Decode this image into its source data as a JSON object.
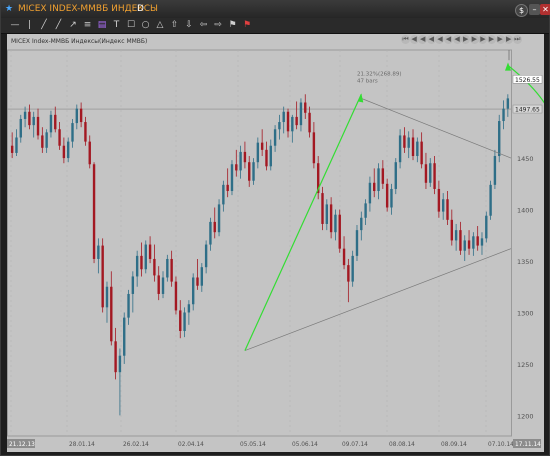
{
  "title": {
    "star": "★",
    "name": "MICEX INDEX-ММВБ ИНДЕКСЫ",
    "period": "D"
  },
  "window": {
    "info": "$",
    "minimize": "–",
    "close": "✕"
  },
  "toolbar": [
    "—",
    "|",
    "╱",
    "╱",
    "↗",
    "≡",
    "▤",
    "T",
    "☐",
    "○",
    "△",
    "⇧",
    "⇩",
    "⇦",
    "⇨",
    "⚑",
    "⚑"
  ],
  "nav_buttons": [
    "⏮",
    "◀",
    "◀",
    "◀",
    "◀",
    "◀",
    "◀",
    "▶",
    "▶",
    "▶",
    "▶",
    "▶",
    "▶",
    "⏭"
  ],
  "chart_data": {
    "type": "candlestick",
    "instrument_label": "MICEX Index-ММВБ Индексы(Индекс ММВБ)",
    "y_ticks": [
      1500,
      1450,
      1400,
      1350,
      1300,
      1250,
      1200
    ],
    "ylim": [
      1180,
      1555
    ],
    "x_ticks": [
      "21.12.13",
      "28.01.14",
      "26.02.14",
      "02.04.14",
      "05.05.14",
      "05.06.14",
      "09.07.14",
      "08.08.14",
      "08.09.14",
      "07.10.14"
    ],
    "first_label": "21.12.13",
    "last_label": "17.11.14",
    "price_labels": [
      {
        "value": "1526.55",
        "y": 1526.55
      },
      {
        "value": "1497.65",
        "y": 1497.65
      }
    ],
    "annotation": {
      "line1": "21.32%(268.89)",
      "line2": "47 bars"
    },
    "candles": [
      {
        "o": 1462,
        "h": 1475,
        "l": 1450,
        "c": 1455
      },
      {
        "o": 1455,
        "h": 1478,
        "l": 1452,
        "c": 1470
      },
      {
        "o": 1470,
        "h": 1492,
        "l": 1465,
        "c": 1488
      },
      {
        "o": 1488,
        "h": 1500,
        "l": 1480,
        "c": 1495
      },
      {
        "o": 1495,
        "h": 1502,
        "l": 1478,
        "c": 1482
      },
      {
        "o": 1482,
        "h": 1495,
        "l": 1470,
        "c": 1490
      },
      {
        "o": 1490,
        "h": 1498,
        "l": 1468,
        "c": 1472
      },
      {
        "o": 1472,
        "h": 1480,
        "l": 1455,
        "c": 1460
      },
      {
        "o": 1460,
        "h": 1478,
        "l": 1455,
        "c": 1475
      },
      {
        "o": 1475,
        "h": 1496,
        "l": 1470,
        "c": 1492
      },
      {
        "o": 1492,
        "h": 1500,
        "l": 1475,
        "c": 1478
      },
      {
        "o": 1478,
        "h": 1485,
        "l": 1458,
        "c": 1462
      },
      {
        "o": 1462,
        "h": 1470,
        "l": 1445,
        "c": 1450
      },
      {
        "o": 1450,
        "h": 1470,
        "l": 1446,
        "c": 1466
      },
      {
        "o": 1466,
        "h": 1488,
        "l": 1460,
        "c": 1484
      },
      {
        "o": 1484,
        "h": 1502,
        "l": 1478,
        "c": 1498
      },
      {
        "o": 1498,
        "h": 1504,
        "l": 1480,
        "c": 1485
      },
      {
        "o": 1485,
        "h": 1490,
        "l": 1462,
        "c": 1466
      },
      {
        "o": 1466,
        "h": 1472,
        "l": 1440,
        "c": 1444
      },
      {
        "o": 1444,
        "h": 1446,
        "l": 1348,
        "c": 1352
      },
      {
        "o": 1352,
        "h": 1372,
        "l": 1338,
        "c": 1365
      },
      {
        "o": 1365,
        "h": 1372,
        "l": 1300,
        "c": 1305
      },
      {
        "o": 1305,
        "h": 1330,
        "l": 1290,
        "c": 1325
      },
      {
        "o": 1325,
        "h": 1340,
        "l": 1268,
        "c": 1272
      },
      {
        "o": 1272,
        "h": 1285,
        "l": 1235,
        "c": 1242
      },
      {
        "o": 1242,
        "h": 1265,
        "l": 1200,
        "c": 1258
      },
      {
        "o": 1258,
        "h": 1300,
        "l": 1250,
        "c": 1295
      },
      {
        "o": 1295,
        "h": 1322,
        "l": 1288,
        "c": 1318
      },
      {
        "o": 1318,
        "h": 1340,
        "l": 1300,
        "c": 1335
      },
      {
        "o": 1335,
        "h": 1360,
        "l": 1325,
        "c": 1355
      },
      {
        "o": 1355,
        "h": 1368,
        "l": 1335,
        "c": 1342
      },
      {
        "o": 1342,
        "h": 1370,
        "l": 1338,
        "c": 1366
      },
      {
        "o": 1366,
        "h": 1374,
        "l": 1348,
        "c": 1352
      },
      {
        "o": 1352,
        "h": 1366,
        "l": 1330,
        "c": 1336
      },
      {
        "o": 1336,
        "h": 1345,
        "l": 1312,
        "c": 1318
      },
      {
        "o": 1318,
        "h": 1340,
        "l": 1314,
        "c": 1334
      },
      {
        "o": 1334,
        "h": 1356,
        "l": 1330,
        "c": 1352
      },
      {
        "o": 1352,
        "h": 1360,
        "l": 1325,
        "c": 1330
      },
      {
        "o": 1330,
        "h": 1335,
        "l": 1298,
        "c": 1302
      },
      {
        "o": 1302,
        "h": 1312,
        "l": 1275,
        "c": 1282
      },
      {
        "o": 1282,
        "h": 1305,
        "l": 1276,
        "c": 1300
      },
      {
        "o": 1300,
        "h": 1312,
        "l": 1288,
        "c": 1308
      },
      {
        "o": 1308,
        "h": 1338,
        "l": 1302,
        "c": 1334
      },
      {
        "o": 1334,
        "h": 1352,
        "l": 1322,
        "c": 1326
      },
      {
        "o": 1326,
        "h": 1348,
        "l": 1320,
        "c": 1344
      },
      {
        "o": 1344,
        "h": 1370,
        "l": 1338,
        "c": 1366
      },
      {
        "o": 1366,
        "h": 1392,
        "l": 1360,
        "c": 1388
      },
      {
        "o": 1388,
        "h": 1402,
        "l": 1372,
        "c": 1378
      },
      {
        "o": 1378,
        "h": 1410,
        "l": 1374,
        "c": 1405
      },
      {
        "o": 1405,
        "h": 1428,
        "l": 1398,
        "c": 1424
      },
      {
        "o": 1424,
        "h": 1440,
        "l": 1412,
        "c": 1418
      },
      {
        "o": 1418,
        "h": 1448,
        "l": 1414,
        "c": 1444
      },
      {
        "o": 1444,
        "h": 1458,
        "l": 1432,
        "c": 1438
      },
      {
        "o": 1438,
        "h": 1462,
        "l": 1430,
        "c": 1456
      },
      {
        "o": 1456,
        "h": 1466,
        "l": 1440,
        "c": 1446
      },
      {
        "o": 1446,
        "h": 1452,
        "l": 1422,
        "c": 1428
      },
      {
        "o": 1428,
        "h": 1450,
        "l": 1424,
        "c": 1446
      },
      {
        "o": 1446,
        "h": 1470,
        "l": 1440,
        "c": 1465
      },
      {
        "o": 1465,
        "h": 1478,
        "l": 1452,
        "c": 1458
      },
      {
        "o": 1458,
        "h": 1466,
        "l": 1438,
        "c": 1442
      },
      {
        "o": 1442,
        "h": 1468,
        "l": 1438,
        "c": 1462
      },
      {
        "o": 1462,
        "h": 1482,
        "l": 1456,
        "c": 1478
      },
      {
        "o": 1478,
        "h": 1492,
        "l": 1468,
        "c": 1485
      },
      {
        "o": 1485,
        "h": 1500,
        "l": 1474,
        "c": 1495
      },
      {
        "o": 1495,
        "h": 1498,
        "l": 1470,
        "c": 1476
      },
      {
        "o": 1476,
        "h": 1492,
        "l": 1465,
        "c": 1490
      },
      {
        "o": 1490,
        "h": 1505,
        "l": 1478,
        "c": 1482
      },
      {
        "o": 1482,
        "h": 1508,
        "l": 1476,
        "c": 1504
      },
      {
        "o": 1504,
        "h": 1512,
        "l": 1488,
        "c": 1494
      },
      {
        "o": 1494,
        "h": 1500,
        "l": 1470,
        "c": 1475
      },
      {
        "o": 1475,
        "h": 1485,
        "l": 1440,
        "c": 1445
      },
      {
        "o": 1445,
        "h": 1452,
        "l": 1410,
        "c": 1416
      },
      {
        "o": 1416,
        "h": 1422,
        "l": 1380,
        "c": 1386
      },
      {
        "o": 1386,
        "h": 1410,
        "l": 1380,
        "c": 1405
      },
      {
        "o": 1405,
        "h": 1412,
        "l": 1372,
        "c": 1378
      },
      {
        "o": 1378,
        "h": 1400,
        "l": 1370,
        "c": 1395
      },
      {
        "o": 1395,
        "h": 1400,
        "l": 1358,
        "c": 1362
      },
      {
        "o": 1362,
        "h": 1374,
        "l": 1342,
        "c": 1346
      },
      {
        "o": 1346,
        "h": 1352,
        "l": 1310,
        "c": 1330
      },
      {
        "o": 1330,
        "h": 1360,
        "l": 1325,
        "c": 1355
      },
      {
        "o": 1355,
        "h": 1385,
        "l": 1350,
        "c": 1380
      },
      {
        "o": 1380,
        "h": 1398,
        "l": 1370,
        "c": 1392
      },
      {
        "o": 1392,
        "h": 1410,
        "l": 1385,
        "c": 1406
      },
      {
        "o": 1406,
        "h": 1432,
        "l": 1398,
        "c": 1426
      },
      {
        "o": 1426,
        "h": 1440,
        "l": 1412,
        "c": 1418
      },
      {
        "o": 1418,
        "h": 1445,
        "l": 1410,
        "c": 1440
      },
      {
        "o": 1440,
        "h": 1448,
        "l": 1420,
        "c": 1425
      },
      {
        "o": 1425,
        "h": 1430,
        "l": 1398,
        "c": 1402
      },
      {
        "o": 1402,
        "h": 1425,
        "l": 1395,
        "c": 1420
      },
      {
        "o": 1420,
        "h": 1450,
        "l": 1415,
        "c": 1446
      },
      {
        "o": 1446,
        "h": 1478,
        "l": 1440,
        "c": 1472
      },
      {
        "o": 1472,
        "h": 1480,
        "l": 1455,
        "c": 1460
      },
      {
        "o": 1460,
        "h": 1476,
        "l": 1450,
        "c": 1470
      },
      {
        "o": 1470,
        "h": 1478,
        "l": 1448,
        "c": 1452
      },
      {
        "o": 1452,
        "h": 1470,
        "l": 1446,
        "c": 1466
      },
      {
        "o": 1466,
        "h": 1475,
        "l": 1440,
        "c": 1444
      },
      {
        "o": 1444,
        "h": 1455,
        "l": 1420,
        "c": 1426
      },
      {
        "o": 1426,
        "h": 1450,
        "l": 1422,
        "c": 1445
      },
      {
        "o": 1445,
        "h": 1452,
        "l": 1415,
        "c": 1420
      },
      {
        "o": 1420,
        "h": 1428,
        "l": 1392,
        "c": 1398
      },
      {
        "o": 1398,
        "h": 1416,
        "l": 1390,
        "c": 1410
      },
      {
        "o": 1410,
        "h": 1418,
        "l": 1385,
        "c": 1390
      },
      {
        "o": 1390,
        "h": 1400,
        "l": 1365,
        "c": 1370
      },
      {
        "o": 1370,
        "h": 1386,
        "l": 1360,
        "c": 1380
      },
      {
        "o": 1380,
        "h": 1388,
        "l": 1356,
        "c": 1360
      },
      {
        "o": 1360,
        "h": 1375,
        "l": 1350,
        "c": 1370
      },
      {
        "o": 1370,
        "h": 1380,
        "l": 1356,
        "c": 1362
      },
      {
        "o": 1362,
        "h": 1378,
        "l": 1355,
        "c": 1374
      },
      {
        "o": 1374,
        "h": 1384,
        "l": 1360,
        "c": 1365
      },
      {
        "o": 1365,
        "h": 1378,
        "l": 1356,
        "c": 1372
      },
      {
        "o": 1372,
        "h": 1398,
        "l": 1368,
        "c": 1394
      },
      {
        "o": 1394,
        "h": 1428,
        "l": 1390,
        "c": 1424
      },
      {
        "o": 1424,
        "h": 1458,
        "l": 1420,
        "c": 1452
      },
      {
        "o": 1452,
        "h": 1492,
        "l": 1446,
        "c": 1486
      },
      {
        "o": 1486,
        "h": 1506,
        "l": 1478,
        "c": 1498
      },
      {
        "o": 1498,
        "h": 1512,
        "l": 1490,
        "c": 1508
      }
    ]
  }
}
